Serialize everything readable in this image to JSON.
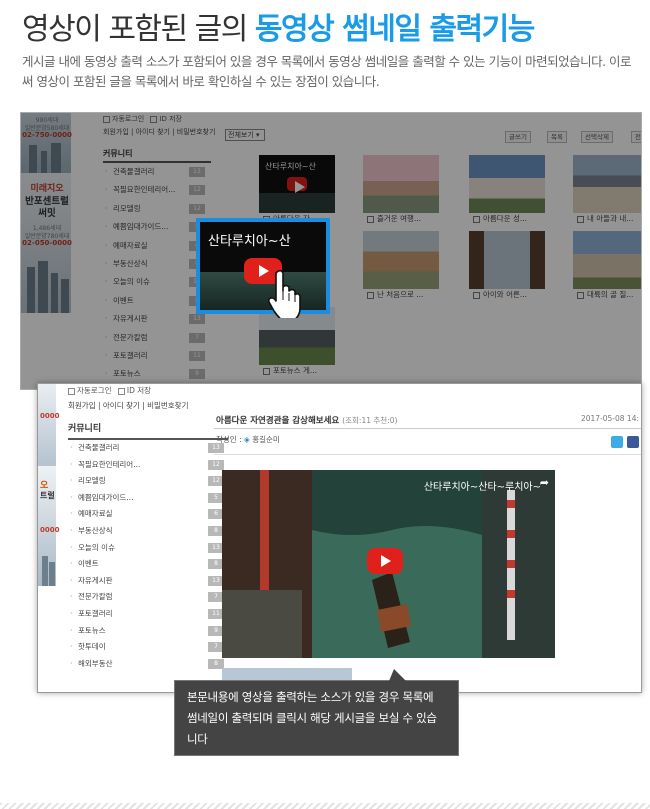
{
  "header": {
    "title_plain": "영상이 포함된 글의 ",
    "title_highlight": "동영상 썸네일 출력기능",
    "description": "게시글 내에 동영상 출력 소스가 포함되어 있을 경우 목록에서 동영상 썸네일을 출력할 수 있는 기능이 마련되었습니다. 이로써 영상이 포함된 글을 목록에서 바로 확인하실 수 있는 장점이 있습니다."
  },
  "sidebar": {
    "auto_login": "자동로그인",
    "id_save": "ID 저장",
    "links": "회원가입 | 아이디 찾기 | 비밀번호찾기",
    "community_title": "커뮤니티",
    "items": [
      {
        "label": "건축물갤러리",
        "count": "13"
      },
      {
        "label": "꼭필요한인테리어...",
        "count": "12"
      },
      {
        "label": "리모델링",
        "count": "12"
      },
      {
        "label": "예쁨임대가이드...",
        "count": "5"
      },
      {
        "label": "예매자료실",
        "count": "6"
      },
      {
        "label": "부동산상식",
        "count": "8"
      },
      {
        "label": "오늘의 이슈",
        "count": "13"
      },
      {
        "label": "이벤트",
        "count": "8"
      },
      {
        "label": "자유게시판",
        "count": "13"
      },
      {
        "label": "전문가칼럼",
        "count": "7"
      },
      {
        "label": "포토갤러리",
        "count": "11"
      },
      {
        "label": "포토뉴스",
        "count": "9"
      },
      {
        "label": "핫투데이",
        "count": "7"
      },
      {
        "label": "해외부동산",
        "count": "8"
      }
    ]
  },
  "banners": {
    "b1_line1": "980세대",
    "b1_line2": "일반분양580세대",
    "b1_phone": "02-750-0000",
    "b2_line1": "미래지오",
    "b2_line2": "반포센트럴",
    "b2_line3": "써밋",
    "b2_line4": "1,486세대",
    "b2_line5": "일반분양780세대",
    "b2_phone": "02-050-0000",
    "s2_phone1": "0000",
    "s2_name1": "오",
    "s2_name2": "트럴",
    "s2_phone2": "0000"
  },
  "list_view": {
    "select_label": "전체보기",
    "toolbar": [
      "글쓰기",
      "목록",
      "선택삭제",
      "전"
    ],
    "captions": {
      "video_top": "아름다운 자...",
      "r1c2": "즐거운 여행...",
      "r1c3": "아름다운 성...",
      "r1c4": "내 아들과 내...",
      "r2c2": "난 처음으로 ...",
      "r2c3": "아이와 어른...",
      "r2c4": "대륙의 골 칠...",
      "r3c1": "포토뉴스 게..."
    },
    "video_title_small": "산타루치아~산",
    "video_title_big": "산타루치아~산"
  },
  "post_view": {
    "title": "아름다운 자연경관을 감상해보세요",
    "meta": "(조회:11 추천:0)",
    "date": "2017-05-08 14:",
    "author_label": "작성인 :",
    "author_name": "홍길순미",
    "video_title": "산타루치아~산타~루치아~"
  },
  "tooltip": {
    "text": "본문내용에 영상을 출력하는 소스가 있을 경우 목록에 썸네일이 출력되며 클릭시 해당 게시글을 보실 수 있습니다"
  }
}
